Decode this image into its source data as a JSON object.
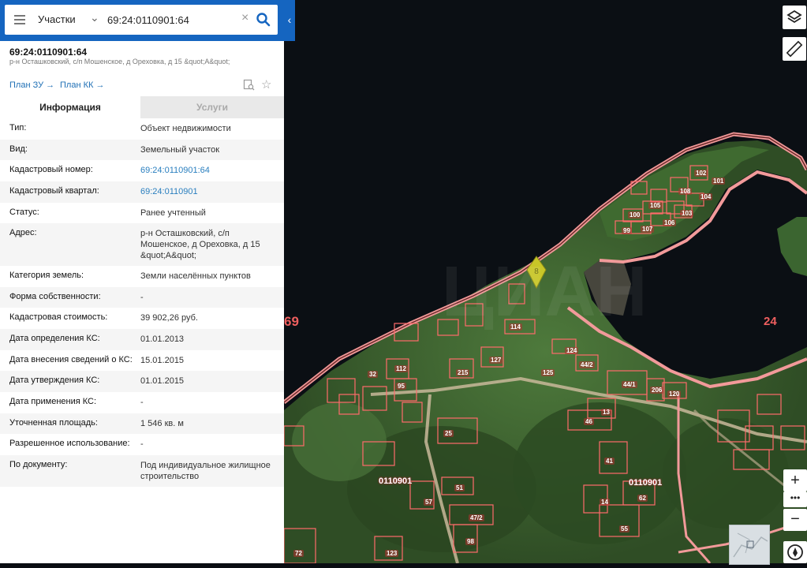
{
  "search": {
    "type_label": "Участки",
    "value": "69:24:0110901:64"
  },
  "object": {
    "cadastral_number": "69:24:0110901:64",
    "address_short": "р-н Осташковский, с/п Мошенское, д Ореховка, д 15 &quot;А&quot;",
    "plan_zu": "План ЗУ →",
    "plan_kk": "План КК →"
  },
  "tabs": {
    "info": "Информация",
    "services": "Услуги"
  },
  "rows": [
    {
      "label": "Тип:",
      "value": "Объект недвижимости"
    },
    {
      "label": "Вид:",
      "value": "Земельный участок"
    },
    {
      "label": "Кадастровый номер:",
      "value": "69:24:0110901:64"
    },
    {
      "label": "Кадастровый квартал:",
      "value": "69:24:0110901"
    },
    {
      "label": "Статус:",
      "value": "Ранее учтенный"
    },
    {
      "label": "Адрес:",
      "value": "р-н Осташковский, с/п Мошенское, д Ореховка, д 15 &quot;А&quot;"
    },
    {
      "label": "Категория земель:",
      "value": "Земли населённых пунктов"
    },
    {
      "label": "Форма собственности:",
      "value": "-"
    },
    {
      "label": "Кадастровая стоимость:",
      "value": "39 902,26 руб."
    },
    {
      "label": "Дата определения КС:",
      "value": "01.01.2013"
    },
    {
      "label": "Дата внесения сведений о КС:",
      "value": "15.01.2015"
    },
    {
      "label": "Дата утверждения КС:",
      "value": "01.01.2015"
    },
    {
      "label": "Дата применения КС:",
      "value": "-"
    },
    {
      "label": "Уточненная площадь:",
      "value": "1 546 кв. м"
    },
    {
      "label": "Разрешенное использование:",
      "value": "-"
    },
    {
      "label": "По документу:",
      "value": "Под индивидуальное жилищное строительство"
    }
  ],
  "map": {
    "quarter_label_1": "0110901",
    "quarter_label_2": "0110901",
    "district_label": "24",
    "district_label_2": "69",
    "parcels": [
      "102",
      "105",
      "108",
      "104",
      "100",
      "107",
      "103",
      "106",
      "99",
      "101",
      "114",
      "125",
      "124",
      "44/2",
      "44/1",
      "120",
      "206",
      "215",
      "127",
      "112",
      "95",
      "25",
      "46",
      "13",
      "51",
      "57",
      "47/2",
      "98",
      "123",
      "72",
      "55",
      "62",
      "14",
      "41",
      "32"
    ]
  },
  "controls": {
    "zoom_in": "+",
    "zoom_dots": "•••",
    "zoom_out": "−"
  },
  "colors": {
    "accent": "#1565c0",
    "link": "#2a7fbf",
    "boundary": "#e8605f",
    "marker": "#c8c628"
  }
}
